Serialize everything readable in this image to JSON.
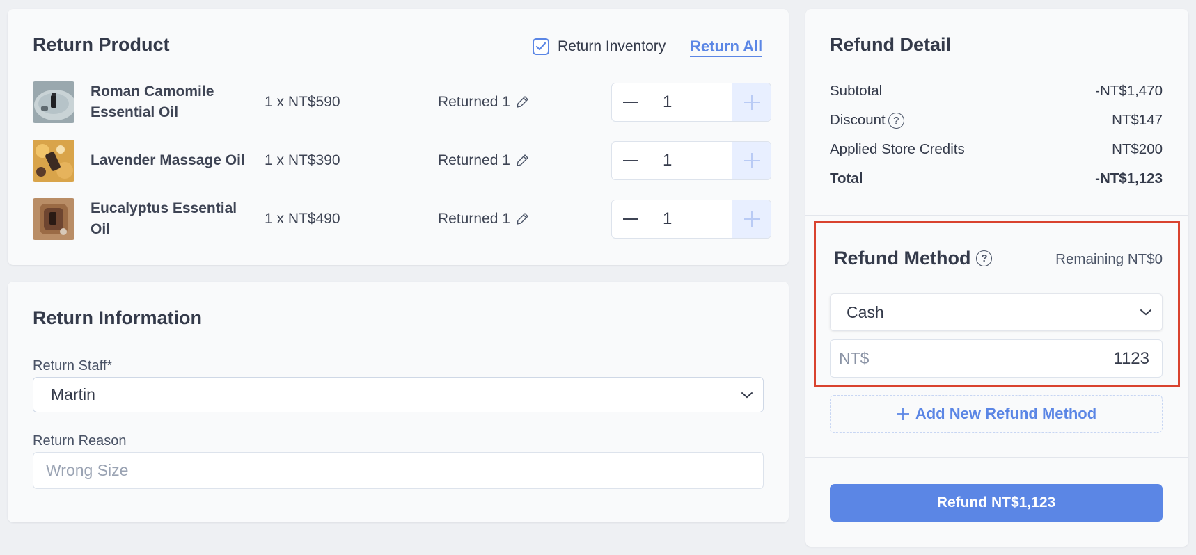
{
  "colors": {
    "accent": "#5b86e5",
    "page_bg": "#eef0f3",
    "card_bg": "#f9fafb",
    "highlight": "#d9432f",
    "text": "#343a4a"
  },
  "return_product": {
    "title": "Return Product",
    "return_inventory_label": "Return Inventory",
    "return_inventory_checked": true,
    "return_all_label": "Return All",
    "items": [
      {
        "name": "Roman Camomile Essential Oil",
        "price": "1 x NT$590",
        "returned": "Returned 1",
        "qty": "1"
      },
      {
        "name": "Lavender Massage Oil",
        "price": "1 x NT$390",
        "returned": "Returned 1",
        "qty": "1"
      },
      {
        "name": "Eucalyptus Essential Oil",
        "price": "1 x NT$490",
        "returned": "Returned 1",
        "qty": "1"
      }
    ]
  },
  "return_information": {
    "title": "Return Information",
    "staff_label": "Return Staff*",
    "staff_value": "Martin",
    "reason_label": "Return Reason",
    "reason_placeholder": "Wrong Size"
  },
  "refund_detail": {
    "title": "Refund Detail",
    "rows": [
      {
        "label": "Subtotal",
        "value": "-NT$1,470"
      },
      {
        "label": "Discount",
        "value": "NT$147"
      },
      {
        "label": "Applied Store Credits",
        "value": "NT$200"
      },
      {
        "label": "Total",
        "value": "-NT$1,123"
      }
    ],
    "refund_method": {
      "title": "Refund Method",
      "remaining": "Remaining NT$0",
      "method_value": "Cash",
      "currency_prefix": "NT$",
      "amount": "1123"
    },
    "add_method_label": "Add New Refund Method",
    "refund_button_label": "Refund NT$1,123"
  }
}
